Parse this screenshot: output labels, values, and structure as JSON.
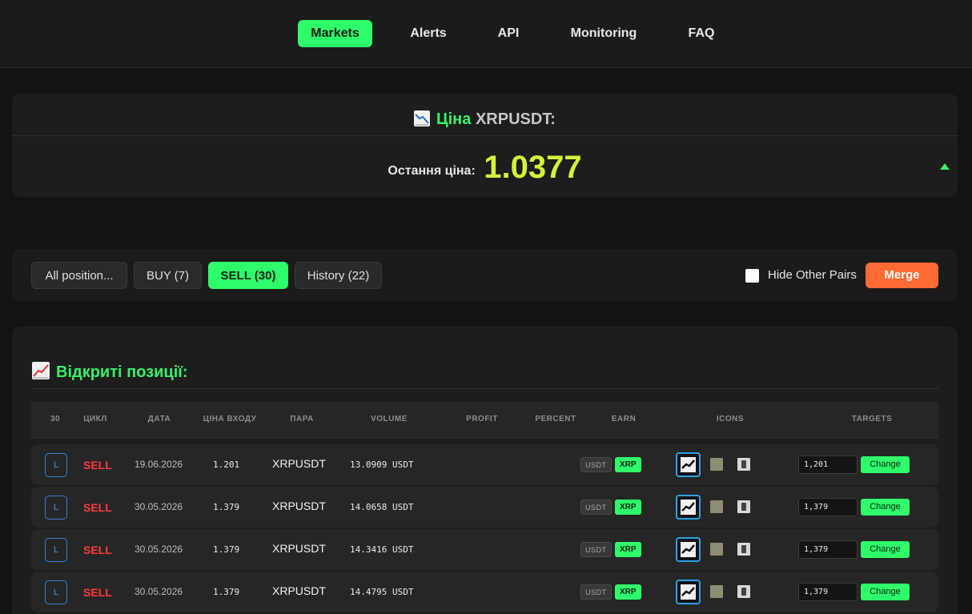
{
  "nav": [
    {
      "label": "Markets",
      "active": true
    },
    {
      "label": "Alerts",
      "active": false
    },
    {
      "label": "API",
      "active": false
    },
    {
      "label": "Monitoring",
      "active": false
    },
    {
      "label": "FAQ",
      "active": false
    }
  ],
  "price": {
    "title_prefix": "Ціна",
    "symbol": "XRPUSDT:",
    "last_label": "Остання ціна:",
    "last_value": "1.0377",
    "trend": "up"
  },
  "filters": {
    "all": "All position...",
    "buy": "BUY (7)",
    "sell": "SELL (30)",
    "history": "History (22)",
    "active": "sell",
    "hide_label": "Hide Other Pairs",
    "hide_checked": false,
    "merge": "Merge"
  },
  "positions": {
    "title": "Відкриті позиції:",
    "headers": [
      "30",
      "ЦИКЛ",
      "ДАТА",
      "ЦІНА ВХОДУ",
      "ПАРА",
      "VOLUME",
      "PROFIT",
      "PERCENT",
      "EARN",
      "ICONS",
      "TARGETS"
    ],
    "rows": [
      {
        "badge": "L",
        "cycle": "SELL",
        "date": "19.06.2026",
        "entry": "1.201",
        "pair": "XRPUSDT",
        "volume": "13.0909 USDT",
        "earn_quote": "USDT",
        "earn_base": "XRP",
        "target": "1,201",
        "change": "Change"
      },
      {
        "badge": "L",
        "cycle": "SELL",
        "date": "30.05.2026",
        "entry": "1.379",
        "pair": "XRPUSDT",
        "volume": "14.0658 USDT",
        "earn_quote": "USDT",
        "earn_base": "XRP",
        "target": "1,379",
        "change": "Change"
      },
      {
        "badge": "L",
        "cycle": "SELL",
        "date": "30.05.2026",
        "entry": "1.379",
        "pair": "XRPUSDT",
        "volume": "14.3416 USDT",
        "earn_quote": "USDT",
        "earn_base": "XRP",
        "target": "1,379",
        "change": "Change"
      },
      {
        "badge": "L",
        "cycle": "SELL",
        "date": "30.05.2026",
        "entry": "1.379",
        "pair": "XRPUSDT",
        "volume": "14.4795 USDT",
        "earn_quote": "USDT",
        "earn_base": "XRP",
        "target": "1,379",
        "change": "Change"
      }
    ]
  },
  "colors": {
    "accent_green": "#2ffc6a",
    "price_yellow": "#d7f23a",
    "sell_red": "#ff3b3b",
    "merge_orange": "#ff6a35",
    "badge_blue": "#3d7fd6"
  }
}
